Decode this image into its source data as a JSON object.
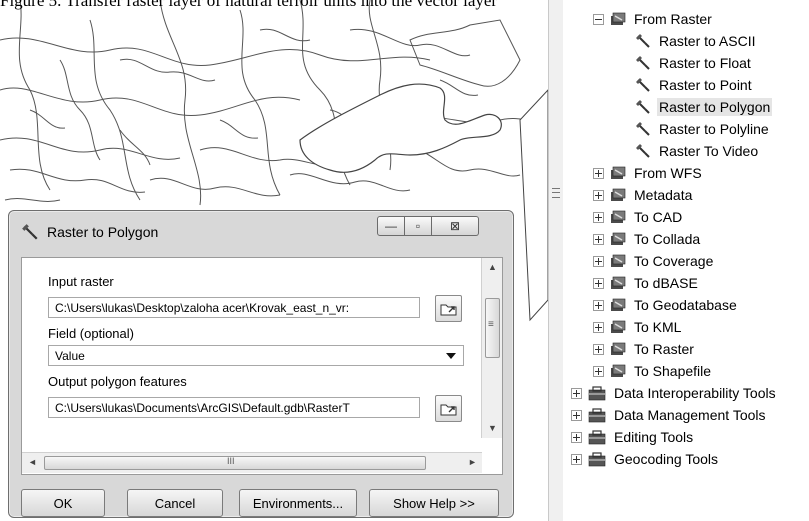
{
  "caption": "Figure 5. Transfer raster layer of natural terroir units into the vector layer",
  "dialog": {
    "title": "Raster to Polygon",
    "window_buttons": {
      "minimize": "—",
      "maximize": "▫",
      "close": "⊠"
    },
    "fields": [
      {
        "label": "Input raster",
        "value": "C:\\Users\\lukas\\Desktop\\zaloha acer\\Krovak_east_n_vr:"
      },
      {
        "label": "Field (optional)",
        "value": "Value"
      },
      {
        "label": "Output polygon features",
        "value": "C:\\Users\\lukas\\Documents\\ArcGIS\\Default.gdb\\RasterT"
      }
    ],
    "scroll_arrows": {
      "up": "▲",
      "down": "▼",
      "left": "◄",
      "right": "►",
      "grip": "≡",
      "hgrip": "III"
    },
    "buttons": {
      "ok": "OK",
      "cancel": "Cancel",
      "environments": "Environments...",
      "show_help": "Show Help >>"
    }
  },
  "toolbox": {
    "from_raster": {
      "label": "From Raster",
      "tools": [
        {
          "label": "Raster to ASCII",
          "selected": false
        },
        {
          "label": "Raster to Float",
          "selected": false
        },
        {
          "label": "Raster to Point",
          "selected": false
        },
        {
          "label": "Raster to Polygon",
          "selected": true
        },
        {
          "label": "Raster to Polyline",
          "selected": false
        },
        {
          "label": "Raster To Video",
          "selected": false
        }
      ]
    },
    "toolsets": [
      "From WFS",
      "Metadata",
      "To CAD",
      "To Collada",
      "To Coverage",
      "To dBASE",
      "To Geodatabase",
      "To KML",
      "To Raster",
      "To Shapefile"
    ],
    "toolboxes": [
      "Data Interoperability Tools",
      "Data Management Tools",
      "Editing Tools",
      "Geocoding Tools"
    ]
  },
  "icons": {
    "hammer": "hammer-icon",
    "toolset": "toolset-icon",
    "toolbox": "toolbox-icon",
    "browse": "folder-browse-icon"
  }
}
